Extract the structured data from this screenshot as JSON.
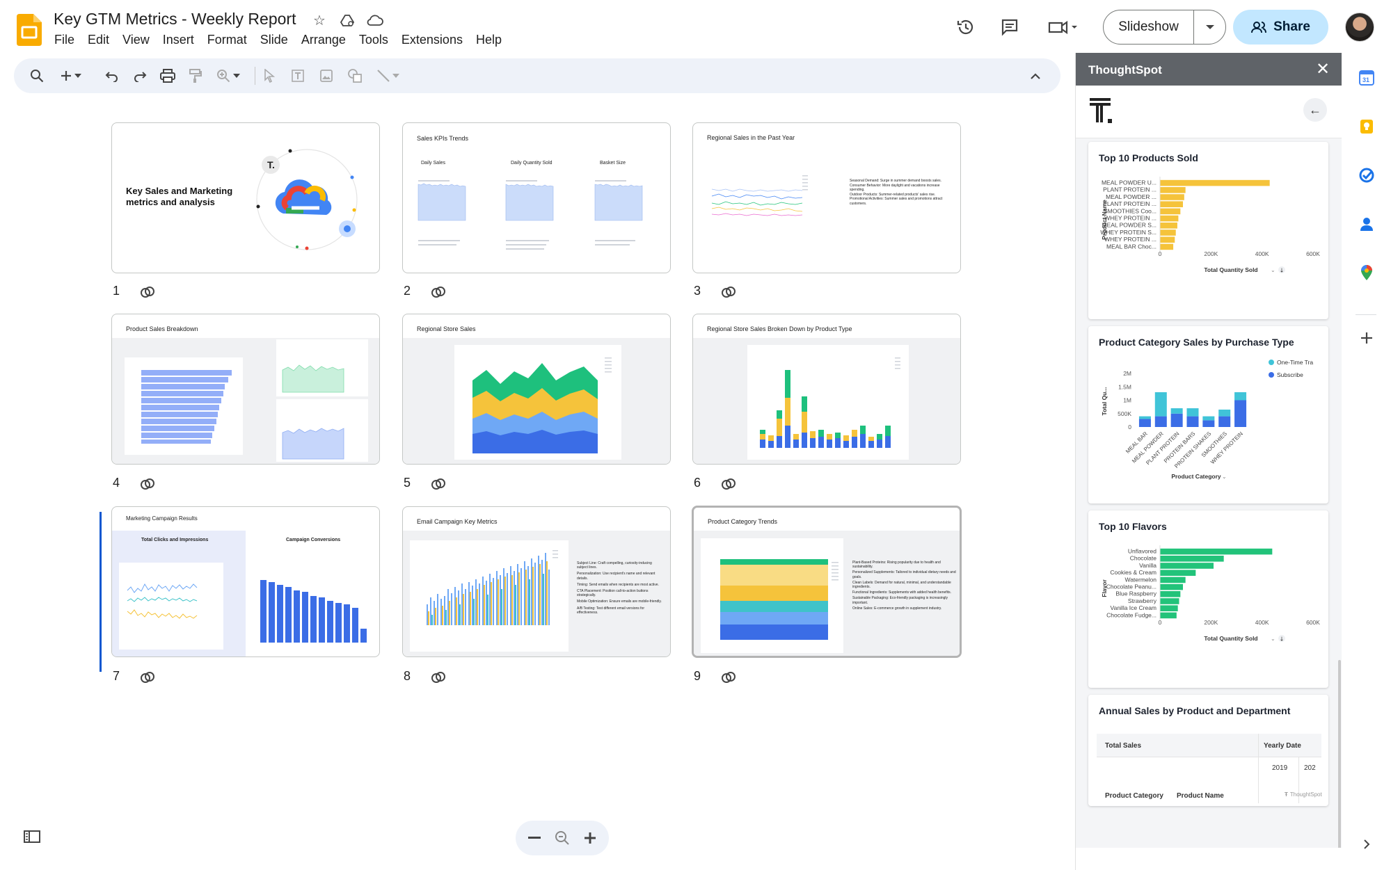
{
  "app": {
    "title": "Key GTM Metrics - Weekly Report",
    "menu": [
      "File",
      "Edit",
      "View",
      "Insert",
      "Format",
      "Slide",
      "Arrange",
      "Tools",
      "Extensions",
      "Help"
    ],
    "slideshow_label": "Slideshow",
    "share_label": "Share"
  },
  "slides": [
    {
      "num": "1",
      "title": "Key Sales and Marketing metrics and analysis"
    },
    {
      "num": "2",
      "title": "Sales KPIs Trends",
      "cols": [
        "Daily Sales",
        "Daily Quantity Sold",
        "Basket Size"
      ]
    },
    {
      "num": "3",
      "title": "Regional Sales in the Past Year",
      "bullets": [
        "Seasonal Demand: Surge in summer demand boosts sales.",
        "Consumer Behavior: More daylight and vacations increase spending.",
        "Outdoor Products: Summer-related products' sales rise.",
        "Promotional Activities: Summer sales and promotions attract customers."
      ]
    },
    {
      "num": "4",
      "title": "Product Sales Breakdown"
    },
    {
      "num": "5",
      "title": "Regional Store Sales"
    },
    {
      "num": "6",
      "title": "Regional Store Sales Broken Down by Product Type"
    },
    {
      "num": "7",
      "title": "Marketing Campaign Results",
      "left": "Total Clicks and Impressions",
      "right": "Campaign Conversions"
    },
    {
      "num": "8",
      "title": "Email Campaign Key Metrics",
      "bullets": [
        "Subject Line: Craft compelling, curiosity-inducing subject lines.",
        "Personalization: Use recipient's name and relevant details.",
        "Timing: Send emails when recipients are most active.",
        "CTA Placement: Position call-to-action buttons strategically.",
        "Mobile Optimization: Ensure emails are mobile-friendly.",
        "A/B Testing: Test different email versions for effectiveness."
      ]
    },
    {
      "num": "9",
      "title": "Product Category Trends",
      "bullets": [
        "Plant-Based Proteins: Rising popularity due to health and sustainability.",
        "Personalized Supplements: Tailored to individual dietary needs and goals.",
        "Clean Labels: Demand for natural, minimal, and understandable ingredients.",
        "Functional Ingredients: Supplements with added health benefits.",
        "Sustainable Packaging: Eco-friendly packaging is increasingly important.",
        "Online Sales: E-commerce growth in supplement industry."
      ]
    }
  ],
  "panel": {
    "title": "ThoughtSpot",
    "cards": {
      "top_products": {
        "title": "Top 10 Products Sold",
        "y_label": "Product Name",
        "x_label": "Total Quantity Sold"
      },
      "category_purchase": {
        "title": "Product Category Sales by Purchase Type",
        "y_label": "Total Qu...",
        "x_label": "Product Category",
        "legend": [
          "One-Time Tra",
          "Subscribe"
        ]
      },
      "top_flavors": {
        "title": "Top 10 Flavors",
        "y_label": "Flavor",
        "x_label": "Total Quantity Sold"
      },
      "annual_sales": {
        "title": "Annual Sales by Product and Department",
        "h1": "Total Sales",
        "h2": "Yearly Date",
        "y1": "2019",
        "y2": "202",
        "c1": "Product Category",
        "c2": "Product Name"
      }
    },
    "footer": "ThoughtSpot"
  },
  "chart_data": [
    {
      "type": "bar",
      "title": "Top 10 Products Sold",
      "orientation": "horizontal",
      "categories": [
        "MEAL POWDER U...",
        "PLANT PROTEIN ...",
        "MEAL POWDER ...",
        "PLANT PROTEIN ...",
        "SMOOTHIES Coo...",
        "WHEY PROTEIN ...",
        "MEAL POWDER S...",
        "WHEY PROTEIN S...",
        "WHEY PROTEIN ...",
        "MEAL BAR Choc..."
      ],
      "values": [
        430000,
        100000,
        95000,
        90000,
        80000,
        72000,
        68000,
        62000,
        58000,
        52000
      ],
      "xticks": [
        "0",
        "200K",
        "400K",
        "600K"
      ],
      "xlim": [
        0,
        600000
      ],
      "ylabel": "Product Name",
      "xlabel": "Total Quantity Sold",
      "color": "#f5c33b"
    },
    {
      "type": "bar",
      "title": "Product Category Sales by Purchase Type",
      "categories": [
        "MEAL BAR",
        "MEAL POWDER",
        "PLANT PROTEIN",
        "PROTEIN BARS",
        "PROTEIN SHAKES",
        "SMOOTHIES",
        "WHEY PROTEIN"
      ],
      "series": [
        {
          "name": "One-Time Tra",
          "values": [
            100000,
            900000,
            200000,
            300000,
            150000,
            250000,
            300000
          ],
          "color": "#40c4d8"
        },
        {
          "name": "Subscribe",
          "values": [
            300000,
            400000,
            500000,
            400000,
            250000,
            400000,
            1000000
          ],
          "color": "#3b6de6"
        }
      ],
      "yticks": [
        "0",
        "500K",
        "1M",
        "1.5M",
        "2M"
      ],
      "ylim": [
        0,
        2000000
      ],
      "ylabel": "Total Qu...",
      "xlabel": "Product Category"
    },
    {
      "type": "bar",
      "title": "Top 10 Flavors",
      "orientation": "horizontal",
      "categories": [
        "Unflavored",
        "Chocolate",
        "Vanilla",
        "Cookies & Cream",
        "Watermelon",
        "Chocolate Peanu...",
        "Blue Raspberry",
        "Strawberry",
        "Vanilla Ice Cream",
        "Chocolate Fudge..."
      ],
      "values": [
        440000,
        250000,
        210000,
        140000,
        100000,
        90000,
        80000,
        75000,
        70000,
        65000
      ],
      "xticks": [
        "0",
        "200K",
        "400K",
        "600K"
      ],
      "xlim": [
        0,
        600000
      ],
      "ylabel": "Flavor",
      "xlabel": "Total Quantity Sold",
      "color": "#22c37a"
    }
  ]
}
